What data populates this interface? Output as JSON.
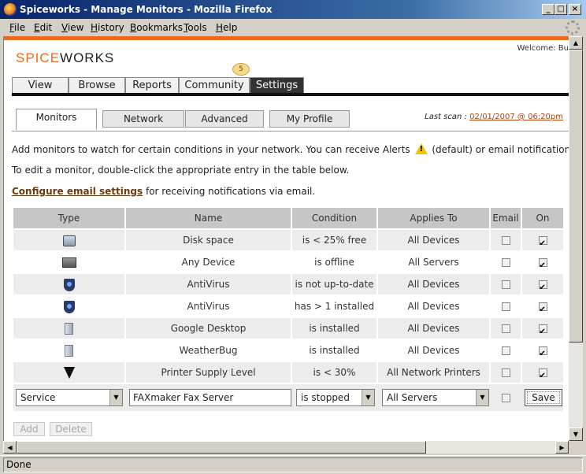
{
  "window": {
    "title": "Spiceworks - Manage Monitors - Mozilla Firefox"
  },
  "menu": [
    "File",
    "Edit",
    "View",
    "History",
    "Bookmarks",
    "Tools",
    "Help"
  ],
  "header": {
    "welcome": "Welcome: Bu",
    "logo_spice": "SPICE",
    "logo_works": "WORKS",
    "community_badge": "5"
  },
  "nav_tabs": [
    "View",
    "Browse",
    "Reports",
    "Community",
    "Settings"
  ],
  "sub_tabs": [
    "Monitors",
    "Network",
    "Advanced",
    "My Profile"
  ],
  "last_scan": {
    "label": "Last scan :",
    "value": "02/01/2007 @ 06:20pm"
  },
  "intro": {
    "line1_a": "Add monitors to watch for certain conditions in your network. You can receive Alerts",
    "line1_b": "(default) or email notifications.",
    "line2": "To edit a monitor, double-click the appropriate entry in the table below.",
    "link": "Configure email settings",
    "line3": "for receiving notifications via email."
  },
  "table": {
    "headers": [
      "Type",
      "Name",
      "Condition",
      "Applies To",
      "Email",
      "On"
    ],
    "rows": [
      {
        "icon": "disk-icon",
        "name": "Disk space",
        "condition": "is < 25% free",
        "applies": "All Devices",
        "email": false,
        "on": true
      },
      {
        "icon": "computer-icon",
        "name": "Any Device",
        "condition": "is offline",
        "applies": "All Servers",
        "email": false,
        "on": true
      },
      {
        "icon": "shield-icon",
        "name": "AntiVirus",
        "condition": "is not up-to-date",
        "applies": "All Devices",
        "email": false,
        "on": true
      },
      {
        "icon": "shield-icon",
        "name": "AntiVirus",
        "condition": "has > 1 installed",
        "applies": "All Devices",
        "email": false,
        "on": true
      },
      {
        "icon": "application-icon",
        "name": "Google Desktop",
        "condition": "is installed",
        "applies": "All Devices",
        "email": false,
        "on": true
      },
      {
        "icon": "application-icon",
        "name": "WeatherBug",
        "condition": "is installed",
        "applies": "All Devices",
        "email": false,
        "on": true
      },
      {
        "icon": "ink-icon",
        "name": "Printer Supply Level",
        "condition": "is < 30%",
        "applies": "All Network Printers",
        "email": false,
        "on": true
      }
    ]
  },
  "edit_row": {
    "type": "Service",
    "name": "FAXmaker Fax Server",
    "condition": "is stopped",
    "applies": "All Servers",
    "save_label": "Save"
  },
  "actions": {
    "add": "Add",
    "delete": "Delete"
  },
  "status": {
    "text": "Done"
  }
}
